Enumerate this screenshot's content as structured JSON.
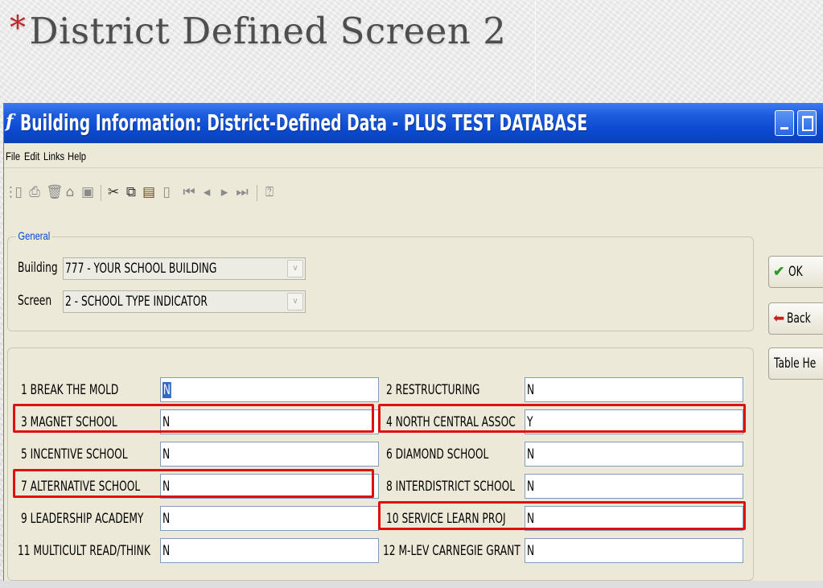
{
  "slide": {
    "bullet": "*",
    "title": "District Defined Screen 2"
  },
  "window": {
    "title": "Building Information: District-Defined Data - PLUS TEST DATABASE",
    "app_icon": "f"
  },
  "menu": [
    "File",
    "Edit",
    "Links",
    "Help"
  ],
  "toolbar_icons": [
    "grip-icon",
    "new-icon",
    "print-icon",
    "delete-icon",
    "open-icon",
    "save-icon",
    "cut-icon",
    "copy-icon",
    "paste-icon",
    "clipboard-icon",
    "first-record-icon",
    "prev-record-icon",
    "next-record-icon",
    "last-record-icon",
    "context-help-icon"
  ],
  "general": {
    "legend": "General",
    "building_label": "Building",
    "building_value": "777 - YOUR SCHOOL BUILDING",
    "screen_label": "Screen",
    "screen_value": "2 - SCHOOL TYPE INDICATOR"
  },
  "fields": [
    {
      "label": "1 BREAK THE MOLD",
      "value": "N"
    },
    {
      "label": "2 RESTRUCTURING",
      "value": "N"
    },
    {
      "label": "3 MAGNET SCHOOL",
      "value": "N"
    },
    {
      "label": "4 NORTH CENTRAL ASSOC",
      "value": "Y"
    },
    {
      "label": "5 INCENTIVE SCHOOL",
      "value": "N"
    },
    {
      "label": "6 DIAMOND SCHOOL",
      "value": "N"
    },
    {
      "label": "7 ALTERNATIVE SCHOOL",
      "value": "N"
    },
    {
      "label": "8 INTERDISTRICT SCHOOL",
      "value": "N"
    },
    {
      "label": "9 LEADERSHIP ACADEMY",
      "value": "N"
    },
    {
      "label": "10 SERVICE LEARN PROJ",
      "value": "N"
    },
    {
      "label": "11 MULTICULT READ/THINK",
      "value": "N"
    },
    {
      "label": "12 M-LEV CARNEGIE GRANT",
      "value": "N"
    }
  ],
  "buttons": {
    "ok": "OK",
    "back": "Back",
    "table_help": "Table He"
  },
  "colors": {
    "highlight": "#e01010",
    "titlebar": "#0a49d0",
    "legend": "#0046d5"
  }
}
